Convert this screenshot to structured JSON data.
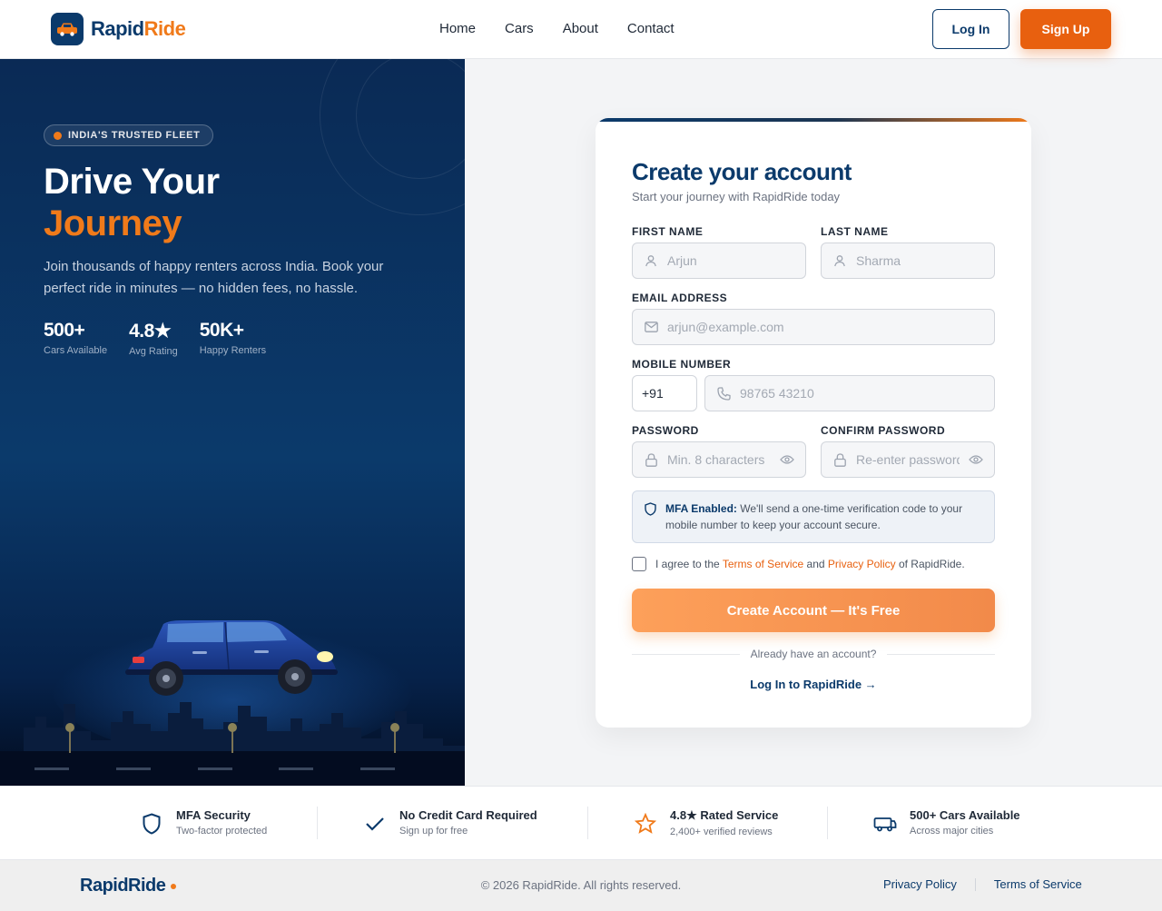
{
  "brand": {
    "name_part1": "Rapid",
    "name_part2": "Ride",
    "footer_name": "RapidRide"
  },
  "nav": {
    "items": [
      "Home",
      "Cars",
      "About",
      "Contact"
    ],
    "login": "Log In",
    "signup": "Sign Up"
  },
  "hero": {
    "badge": "INDIA'S TRUSTED FLEET",
    "title_line1": "Drive Your",
    "title_line2": "Journey",
    "description": "Join thousands of happy renters across India. Book your perfect ride in minutes — no hidden fees, no hassle.",
    "stats": [
      {
        "value": "500+",
        "label": "Cars Available"
      },
      {
        "value": "4.8★",
        "label": "Avg Rating"
      },
      {
        "value": "50K+",
        "label": "Happy Renters"
      }
    ]
  },
  "form": {
    "title": "Create your account",
    "subtitle": "Start your journey with RapidRide today",
    "first_name": {
      "label": "FIRST NAME",
      "placeholder": "Arjun",
      "icon": "user-icon"
    },
    "last_name": {
      "label": "LAST NAME",
      "placeholder": "Sharma",
      "icon": "user-icon"
    },
    "email": {
      "label": "EMAIL ADDRESS",
      "placeholder": "arjun@example.com",
      "icon": "mail-icon"
    },
    "mobile": {
      "label": "MOBILE NUMBER",
      "country_code": "+91",
      "placeholder": "98765 43210",
      "icon": "phone-icon"
    },
    "password": {
      "label": "PASSWORD",
      "placeholder": "Min. 8 characters",
      "icon": "lock-icon"
    },
    "confirm_password": {
      "label": "CONFIRM PASSWORD",
      "placeholder": "Re-enter password",
      "icon": "lock-icon"
    },
    "mfa": {
      "title": "MFA Enabled:",
      "text": "We'll send a one-time verification code to your mobile number to keep your account secure."
    },
    "agree": {
      "prefix": "I agree to the",
      "terms": "Terms of Service",
      "and": "and",
      "privacy": "Privacy Policy",
      "suffix": "of RapidRide."
    },
    "submit": "Create Account — It's Free",
    "divider": "Already have an account?",
    "login_link": "Log In to RapidRide →"
  },
  "features": [
    {
      "title": "MFA Security",
      "subtitle": "Two-factor protected",
      "icon": "shield-icon"
    },
    {
      "title": "No Credit Card Required",
      "subtitle": "Sign up for free",
      "icon": "check-icon"
    },
    {
      "title": "4.8★ Rated Service",
      "subtitle": "2,400+ verified reviews",
      "icon": "star-icon"
    },
    {
      "title": "500+ Cars Available",
      "subtitle": "Across major cities",
      "icon": "car-icon"
    }
  ],
  "footer": {
    "copyright": "© 2026 RapidRide. All rights reserved.",
    "privacy": "Privacy Policy",
    "terms": "Terms of Service"
  },
  "colors": {
    "primary": "#0b3a6b",
    "accent": "#f07a1a",
    "accent_dark": "#e8600f"
  }
}
